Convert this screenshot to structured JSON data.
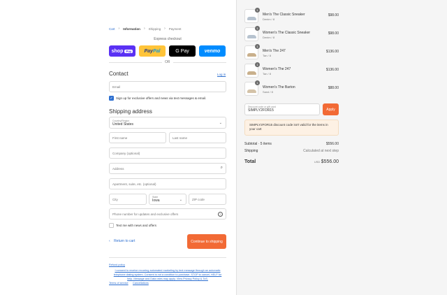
{
  "breadcrumb": [
    "Cart",
    "Information",
    "Shipping",
    "Payment"
  ],
  "express": {
    "title": "Express checkout",
    "shop_pay": "shop",
    "shop_pay_badge": "Pay",
    "paypal_a": "Pay",
    "paypal_b": "Pal",
    "gpay": "G Pay",
    "venmo": "venmo",
    "or": "OR"
  },
  "contact": {
    "title": "Contact",
    "login": "Log in",
    "email_placeholder": "Email",
    "offers_label": "Sign up for exclusive offers and news via text messages & email."
  },
  "shipping": {
    "title": "Shipping address",
    "country_label": "Country/Region",
    "country_value": "United States",
    "first_name": "First name",
    "last_name": "Last name",
    "company": "Company (optional)",
    "address": "Address",
    "apartment": "Apartment, suite, etc. (optional)",
    "city": "City",
    "state_label": "State",
    "state_value": "Iowa",
    "zip": "ZIP code",
    "phone": "Phone number for updates and exclusive offers",
    "text_me": "Text me with news and offers"
  },
  "actions": {
    "return": "Return to cart",
    "continue": "Continue to shipping"
  },
  "footer": {
    "refund": "Refund policy",
    "consent_1": "I consent to receive recurring automated marketing by text message through an automatic",
    "consent_2": "telephone dialing system. Consent is not a condition to purchase. STOP to cancel, HELP for",
    "consent_3": "help. Message and Data rates may apply. View Privacy Policy & ToS.",
    "terms": "Terms of service",
    "cancellations": "Cancellations"
  },
  "items": [
    {
      "qty": "1",
      "name": "Men's The Classic Sneaker",
      "variant": "Denim / 8",
      "price": "$98.00",
      "shoe_color": "#b7c3cf"
    },
    {
      "qty": "1",
      "name": "Women's The Classic Sneaker",
      "variant": "Denim / 8",
      "price": "$98.00",
      "shoe_color": "#b7c3cf"
    },
    {
      "qty": "1",
      "name": "Men's The 247",
      "variant": "Tan / 8",
      "price": "$136.00",
      "shoe_color": "#c9b08c"
    },
    {
      "qty": "1",
      "name": "Women's The 247",
      "variant": "Tan / 8",
      "price": "$136.00",
      "shoe_color": "#c9b08c"
    },
    {
      "qty": "1",
      "name": "Women's The Barton",
      "variant": "Sand / 8",
      "price": "$88.00",
      "shoe_color": "#d4c3a8"
    }
  ],
  "discount": {
    "label": "Discount code or gift card",
    "value": "SIMPLY2FOR15",
    "apply": "Apply",
    "warning_1": "SIMPLY2FOR15 discount code isn't valid for the items in",
    "warning_2": "your cart"
  },
  "summary": {
    "subtotal_label": "Subtotal · 5 items",
    "subtotal": "$556.00",
    "shipping_label": "Shipping",
    "shipping": "Calculated at next step",
    "total_label": "Total",
    "currency": "USD",
    "total": "$556.00"
  },
  "colors": {
    "accent": "#f26a35",
    "link": "#2d6fd0"
  }
}
